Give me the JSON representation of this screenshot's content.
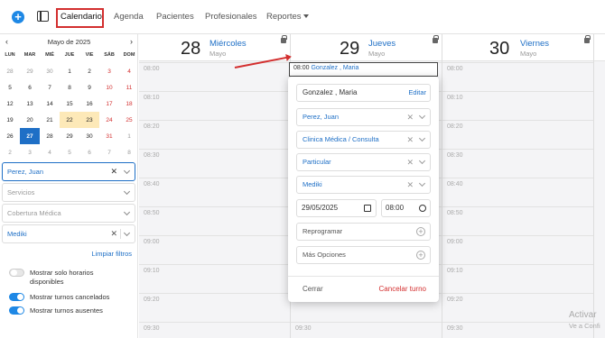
{
  "nav": {
    "items": [
      "Calendario",
      "Agenda",
      "Pacientes",
      "Profesionales",
      "Reportes"
    ]
  },
  "mini_calendar": {
    "title": "Mayo de 2025",
    "prev": "‹",
    "next": "›",
    "weekdays": [
      "LUN",
      "MAR",
      "MIÉ",
      "JUE",
      "VIE",
      "SÁB",
      "DOM"
    ],
    "weeks": [
      [
        "28",
        "29",
        "30",
        "1",
        "2",
        "3",
        "4"
      ],
      [
        "5",
        "6",
        "7",
        "8",
        "9",
        "10",
        "11"
      ],
      [
        "12",
        "13",
        "14",
        "15",
        "16",
        "17",
        "18"
      ],
      [
        "19",
        "20",
        "21",
        "22",
        "23",
        "24",
        "25"
      ],
      [
        "26",
        "27",
        "28",
        "29",
        "30",
        "31",
        "1"
      ],
      [
        "2",
        "3",
        "4",
        "5",
        "6",
        "7",
        "8"
      ]
    ],
    "selected": "27"
  },
  "filters": {
    "professional": "Perez, Juan",
    "services_placeholder": "Servicios",
    "coverage_placeholder": "Cobertura Médica",
    "coverage": "Mediki",
    "clear": "Limpiar filtros"
  },
  "toggles": [
    {
      "label": "Mostrar solo horarios disponibles",
      "on": false
    },
    {
      "label": "Mostrar turnos cancelados",
      "on": true
    },
    {
      "label": "Mostrar turnos ausentes",
      "on": true
    }
  ],
  "columns": [
    {
      "num": "28",
      "weekday": "Miércoles",
      "month": "Mayo"
    },
    {
      "num": "29",
      "weekday": "Jueves",
      "month": "Mayo"
    },
    {
      "num": "30",
      "weekday": "Viernes",
      "month": "Mayo"
    }
  ],
  "time_slots": [
    "08:00",
    "08:10",
    "08:20",
    "08:30",
    "08:40",
    "08:50",
    "09:00",
    "09:10",
    "09:20",
    "09:30"
  ],
  "event": {
    "time": "08:00",
    "name": "Gonzalez , Maria"
  },
  "popover": {
    "patient": "Gonzalez , Maria",
    "edit": "Editar",
    "professional": "Perez, Juan",
    "service": "Clinica Médica / Consulta",
    "type": "Particular",
    "coverage": "Mediki",
    "date": "29/05/2025",
    "time": "08:00",
    "reprogram": "Reprogramar",
    "more": "Más Opciones",
    "close": "Cerrar",
    "cancel": "Cancelar turno"
  },
  "watermark": {
    "line1": "Activar",
    "line2": "Ve a Confi"
  },
  "colors": {
    "accent": "#1e6fc6",
    "danger": "#d32f2f",
    "highlight": "#fde9b8"
  }
}
